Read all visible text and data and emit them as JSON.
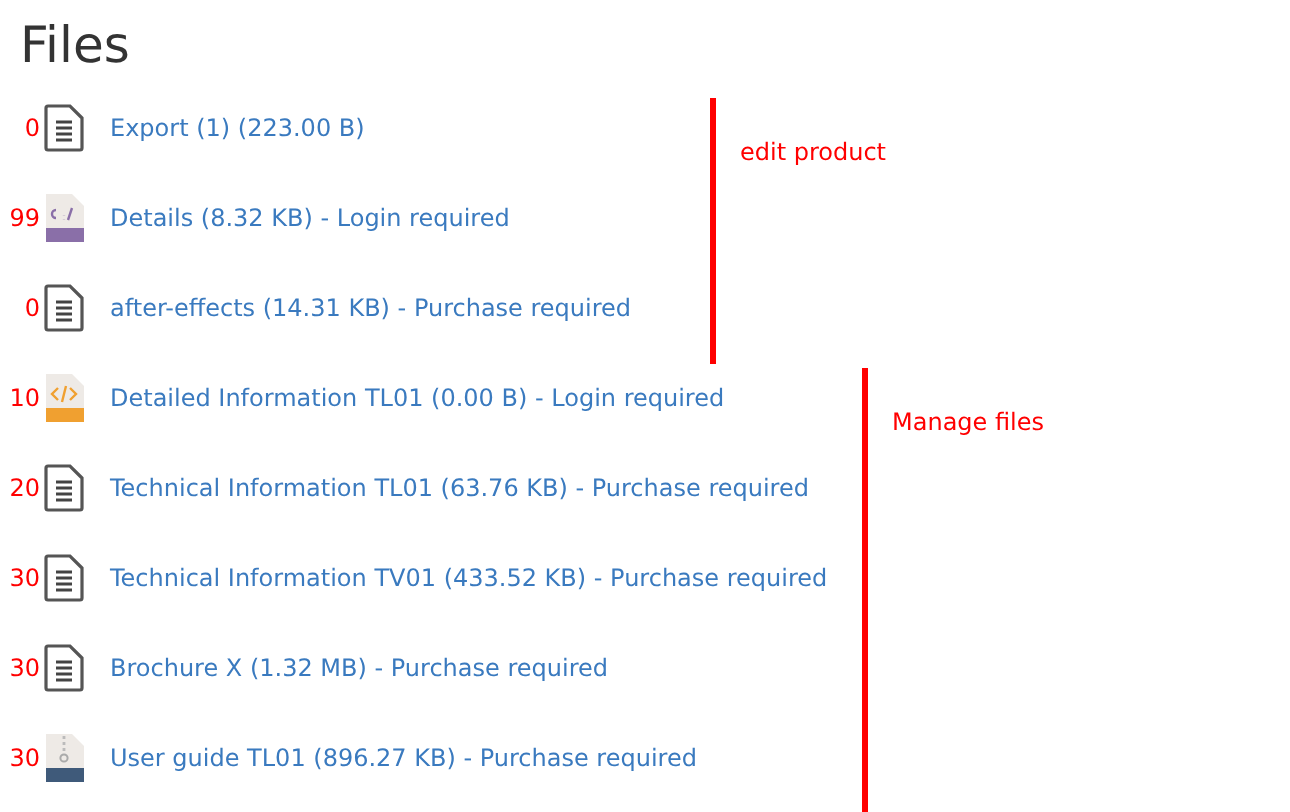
{
  "title": "Files",
  "files": [
    {
      "count": "0",
      "kind": "doc",
      "label": "Export (1) (223.00 B)"
    },
    {
      "count": "99",
      "kind": "exe",
      "label": "Details (8.32 KB) - Login required"
    },
    {
      "count": "0",
      "kind": "doc",
      "label": "after-effects (14.31 KB) - Purchase required"
    },
    {
      "count": "10",
      "kind": "xml",
      "label": "Detailed Information TL01 (0.00 B) - Login required"
    },
    {
      "count": "20",
      "kind": "doc",
      "label": "Technical Information TL01 (63.76 KB) - Purchase required"
    },
    {
      "count": "30",
      "kind": "doc",
      "label": "Technical Information TV01 (433.52 KB) - Purchase required"
    },
    {
      "count": "30",
      "kind": "doc",
      "label": "Brochure X (1.32 MB) - Purchase required"
    },
    {
      "count": "30",
      "kind": "zip",
      "label": "User guide TL01 (896.27 KB) - Purchase required"
    }
  ],
  "annotations": [
    {
      "label": "edit product"
    },
    {
      "label": "Manage files"
    }
  ]
}
